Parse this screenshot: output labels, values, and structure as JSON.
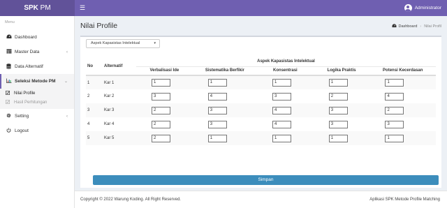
{
  "header": {
    "logo_bold": "SPK",
    "logo_rest": "PM",
    "menu_icon": "☰",
    "user_name": "Administrator"
  },
  "sidebar": {
    "menu_label": "Menu",
    "items": [
      {
        "label": "Dashboard",
        "icon": "dashboard-icon"
      },
      {
        "label": "Master Data",
        "icon": "table-icon"
      },
      {
        "label": "Data Alternatif",
        "icon": "database-icon"
      },
      {
        "label": "Seleksi Metode PM",
        "icon": "chart-icon"
      },
      {
        "label": "Setting",
        "icon": "gear-icon"
      },
      {
        "label": "Logout",
        "icon": "power-icon"
      }
    ],
    "sub_items": [
      {
        "label": "Nilai Profile"
      },
      {
        "label": "Hasil Perhitungan"
      }
    ]
  },
  "page": {
    "title": "Nilai Profile",
    "breadcrumb_home": "Dashboard",
    "breadcrumb_current": "Nilai Profil"
  },
  "form": {
    "aspect_select": "Aspek Kapasistas Intelektual",
    "submit_label": "Simpan"
  },
  "table": {
    "col_no": "No",
    "col_alt": "Alternatif",
    "group_header": "Aspek Kapasistas Intelektual",
    "criteria": [
      "Verbalisasi Ide",
      "Sistematika Berfikir",
      "Konsentrasi",
      "Logika Praktis",
      "Potensi Kecerdasan"
    ],
    "rows": [
      {
        "no": "1",
        "name": "Kar 1",
        "values": [
          "1",
          "1",
          "1",
          "1",
          "1"
        ]
      },
      {
        "no": "2",
        "name": "Kar 2",
        "values": [
          "3",
          "4",
          "3",
          "2",
          "4"
        ]
      },
      {
        "no": "3",
        "name": "Kar 3",
        "values": [
          "2",
          "3",
          "4",
          "3",
          "2"
        ]
      },
      {
        "no": "4",
        "name": "Kar 4",
        "values": [
          "2",
          "3",
          "4",
          "3",
          "3"
        ]
      },
      {
        "no": "5",
        "name": "Kar 5",
        "values": [
          "2",
          "1",
          "1",
          "1",
          "1"
        ]
      }
    ]
  },
  "footer": {
    "copyright": "Copyright © 2022 Warung Koding. All Right Reserved.",
    "app_name": "Aplikasi SPK Metode Profile Matching"
  },
  "colors": {
    "header": "#6f5fb1",
    "logo": "#615299",
    "primary_button": "#3c8dbc"
  }
}
